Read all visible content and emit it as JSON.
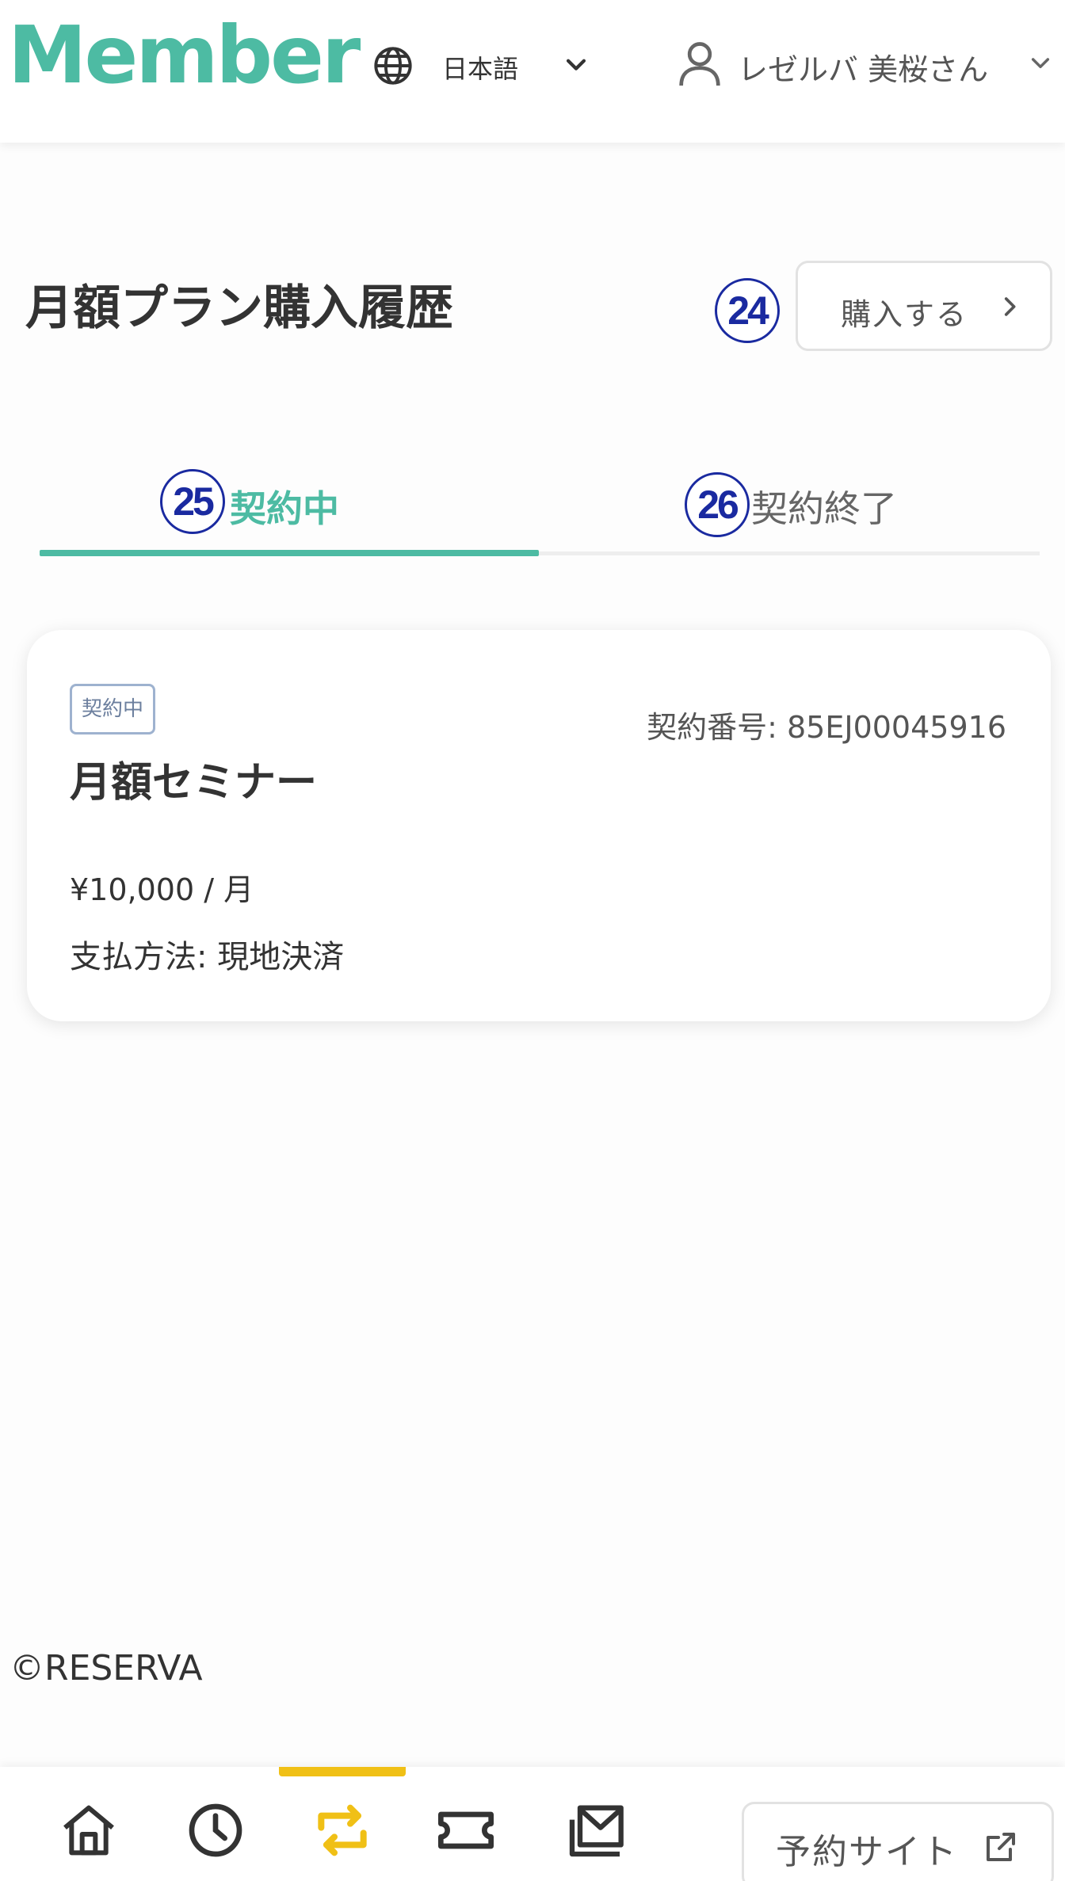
{
  "header": {
    "logo": "Member",
    "language": "日本語",
    "user_name": "レゼルバ 美桜さん"
  },
  "main": {
    "title": "月額プラン購入履歴",
    "purchase_button": "購入する",
    "markers": {
      "purchase": "24",
      "tab_active": "25",
      "tab_ended": "26"
    },
    "tabs": [
      {
        "label": "契約中",
        "active": true
      },
      {
        "label": "契約終了",
        "active": false
      }
    ],
    "contract": {
      "status_badge": "契約中",
      "contract_number": "契約番号: 85EJ00045916",
      "plan_name": "月額セミナー",
      "price": "¥10,000 / 月",
      "payment_method": "支払方法: 現地決済"
    }
  },
  "footer": {
    "copyright": "©RESERVA"
  },
  "bottom_nav": {
    "items": [
      {
        "icon": "home-icon",
        "active": false
      },
      {
        "icon": "history-clock-icon",
        "active": false
      },
      {
        "icon": "subscription-repeat-icon",
        "active": true
      },
      {
        "icon": "ticket-icon",
        "active": false
      },
      {
        "icon": "mail-icon",
        "active": false
      }
    ],
    "reservation_site_label": "予約サイト"
  },
  "colors": {
    "brand": "#4dbba3",
    "active_nav": "#f0c016",
    "marker": "#1a2aa0",
    "text": "#333333",
    "badge_border": "#9eb2cf"
  }
}
